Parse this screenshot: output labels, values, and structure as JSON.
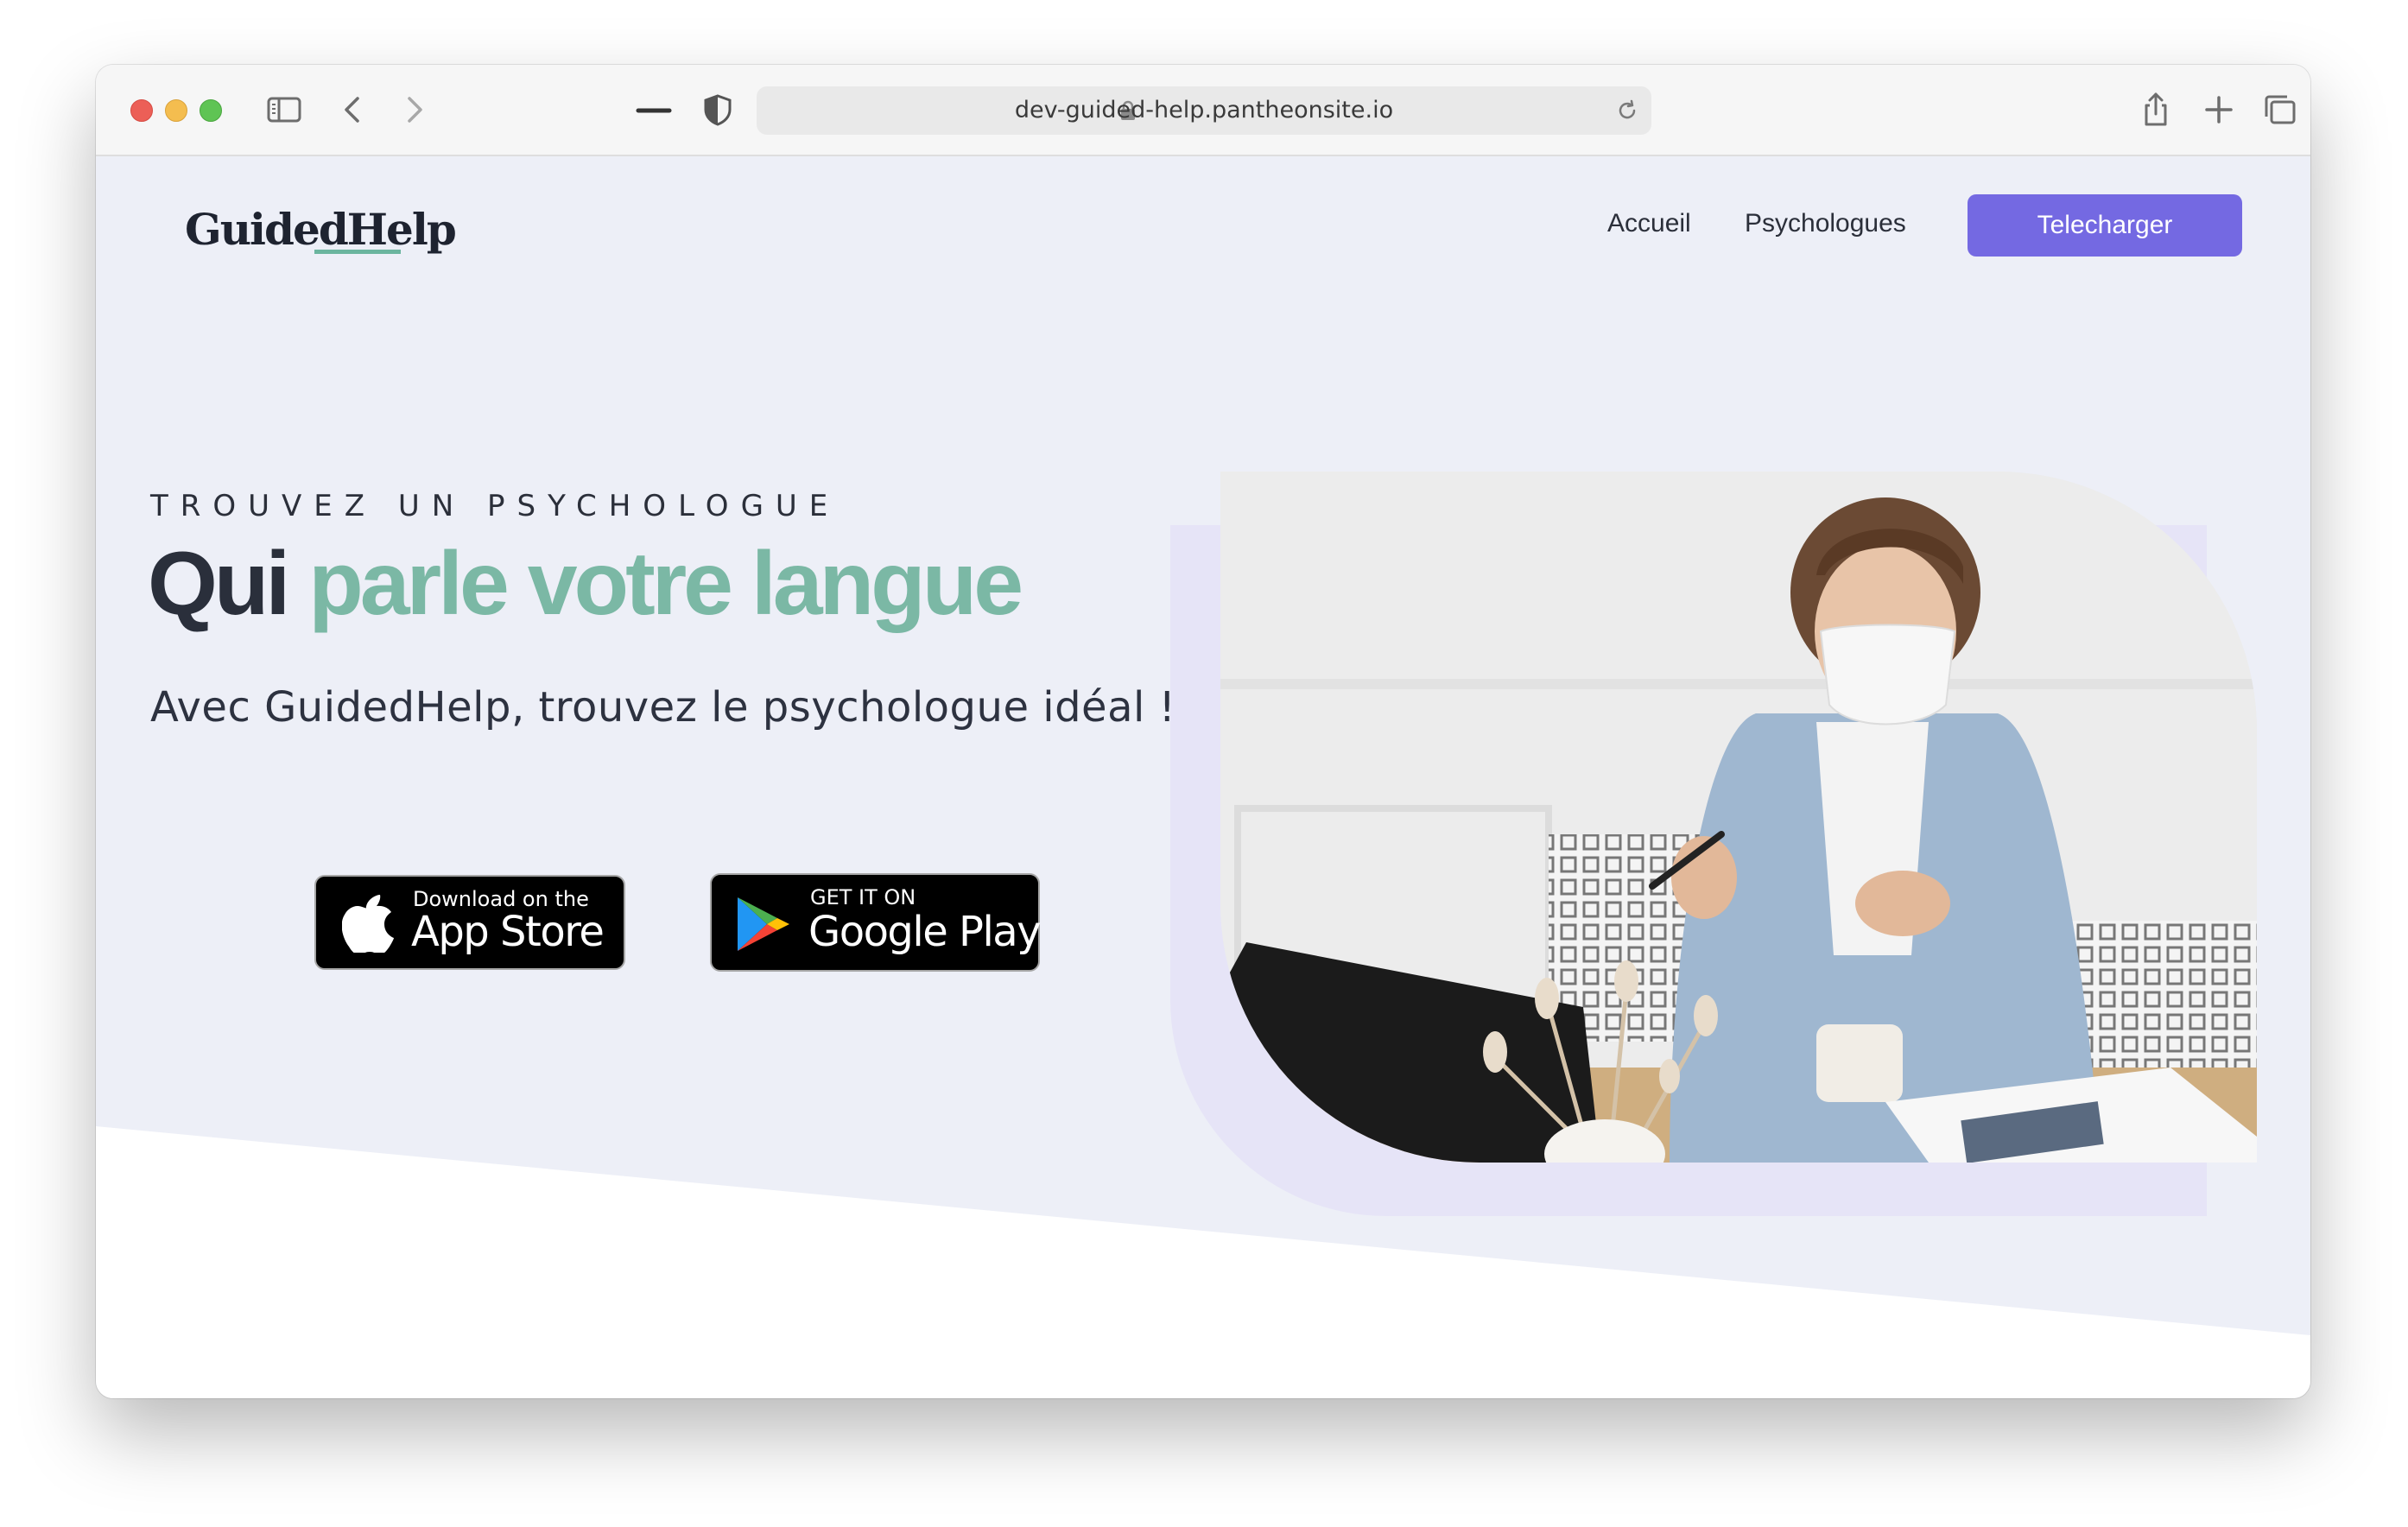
{
  "browser": {
    "url": "dev-guided-help.pantheonsite.io",
    "icons": [
      "sidebar-icon",
      "back-icon",
      "forward-icon",
      "minimize-icon",
      "shield-icon",
      "lock-icon",
      "reload-icon",
      "share-icon",
      "new-tab-icon",
      "tabs-overview-icon"
    ]
  },
  "header": {
    "logo_text": "GuidedHelp",
    "nav": [
      {
        "label": "Accueil"
      },
      {
        "label": "Psychologues"
      }
    ],
    "cta_label": "Telecharger"
  },
  "hero": {
    "eyebrow": "TROUVEZ UN PSYCHOLOGUE",
    "headline_dark": "Qui",
    "headline_accent": "parle votre langue",
    "subtitle": "Avec GuidedHelp, trouvez le psychologue idéal !",
    "app_store": {
      "small": "Download on the",
      "big": "App Store"
    },
    "google_play": {
      "small": "GET IT ON",
      "big": "Google Play"
    }
  },
  "colors": {
    "page_bg": "#edeff7",
    "accent_purple": "#7469e2",
    "accent_green": "#7bb8a5",
    "hero_shape": "#e6e4f7",
    "text_dark": "#2a2f3b"
  }
}
